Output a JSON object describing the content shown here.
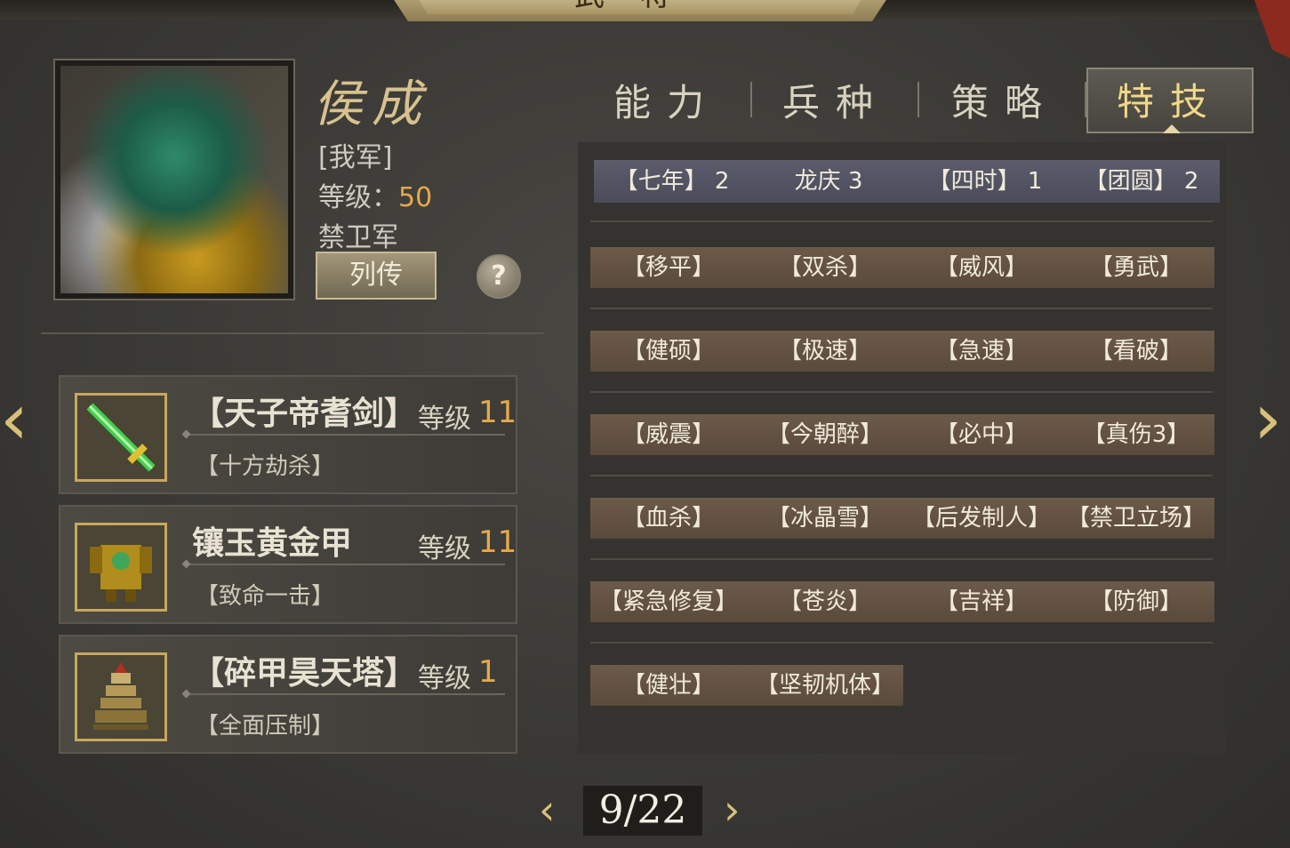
{
  "title": "武将",
  "general": {
    "name": "侯成",
    "faction": "[我军]",
    "level_label": "等级：",
    "level": "50",
    "troop": "禁卫军",
    "bio_button": "列传",
    "help_button": "?"
  },
  "tabs": [
    {
      "label": "能力",
      "active": false
    },
    {
      "label": "兵种",
      "active": false
    },
    {
      "label": "策略",
      "active": false
    },
    {
      "label": "特技",
      "active": true
    }
  ],
  "equipment": [
    {
      "name": "【天子帝耆剑】",
      "level_label": "等级",
      "level": "11",
      "skill": "【十方劫杀】",
      "icon": "sword-icon"
    },
    {
      "name": "镶玉黄金甲",
      "level_label": "等级",
      "level": "11",
      "skill": "【致命一击】",
      "icon": "armor-icon"
    },
    {
      "name": "【碎甲昊天塔】",
      "level_label": "等级",
      "level": "1",
      "skill": "【全面压制】",
      "icon": "pagoda-icon"
    }
  ],
  "skills": {
    "top": [
      "【七年】 2",
      "龙庆 3",
      "【四时】 1",
      "【团圆】 2"
    ],
    "rows": [
      [
        "【移平】",
        "【双杀】",
        "【威风】",
        "【勇武】"
      ],
      [
        "【健硕】",
        "【极速】",
        "【急速】",
        "【看破】"
      ],
      [
        "【威震】",
        "【今朝醉】",
        "【必中】",
        "【真伤3】"
      ],
      [
        "【血杀】",
        "【冰晶雪】",
        "【后发制人】",
        "【禁卫立场】"
      ],
      [
        "【紧急修复】",
        "【苍炎】",
        "【吉祥】",
        "【防御】"
      ],
      [
        "【健壮】",
        "【坚韧机体】"
      ]
    ]
  },
  "pager": {
    "text": "9/22",
    "prev": "‹",
    "next": "›"
  },
  "nav": {
    "prev": "‹",
    "next": "›"
  },
  "colors": {
    "accent": "#e6a94b",
    "gold": "#d7c28e"
  }
}
